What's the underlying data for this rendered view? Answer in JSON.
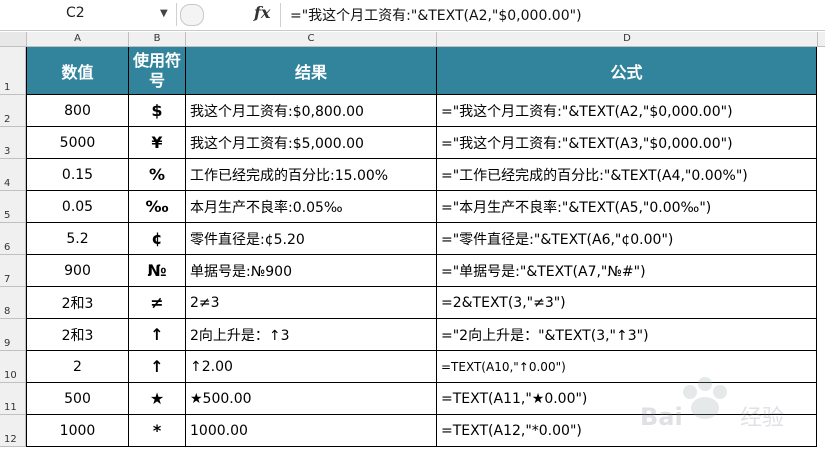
{
  "formula_bar": {
    "cell_ref": "C2",
    "fx_label": "fx",
    "formula": "=\"我这个月工资有:\"&TEXT(A2,\"$0,000.00\")"
  },
  "columns": [
    "A",
    "B",
    "C",
    "D"
  ],
  "rows": [
    "1",
    "2",
    "3",
    "4",
    "5",
    "6",
    "7",
    "8",
    "9",
    "10",
    "11",
    "12"
  ],
  "header": {
    "a": "数值",
    "b": "使用符号",
    "c": "结果",
    "d": "公式"
  },
  "data_rows": [
    {
      "a": "800",
      "b": "$",
      "c": "我这个月工资有:$0,800.00",
      "d": "=\"我这个月工资有:\"&TEXT(A2,\"$0,000.00\")"
    },
    {
      "a": "5000",
      "b": "¥",
      "c": "我这个月工资有:$5,000.00",
      "d": "=\"我这个月工资有:\"&TEXT(A3,\"$0,000.00\")"
    },
    {
      "a": "0.15",
      "b": "%",
      "c": "工作已经完成的百分比:15.00%",
      "d": "=\"工作已经完成的百分比:\"&TEXT(A4,\"0.00%\")"
    },
    {
      "a": "0.05",
      "b": "‰",
      "c": "本月生产不良率:0.05‰",
      "d": "=\"本月生产不良率:\"&TEXT(A5,\"0.00‰\")"
    },
    {
      "a": "5.2",
      "b": "¢",
      "c": "零件直径是:¢5.20",
      "d": "=\"零件直径是:\"&TEXT(A6,\"¢0.00\")"
    },
    {
      "a": "900",
      "b": "№",
      "c": "单据号是:№900",
      "d": "=\"单据号是:\"&TEXT(A7,\"№#\")"
    },
    {
      "a": "2和3",
      "b": "≠",
      "c": "2≠3",
      "d": "=2&TEXT(3,\"≠3\")"
    },
    {
      "a": "2和3",
      "b": "↑",
      "c": "2向上升是：↑3",
      "d": "=\"2向上升是：\"&TEXT(3,\"↑3\")"
    },
    {
      "a": "2",
      "b": "↑",
      "c": "↑2.00",
      "d": "=TEXT(A10,\"↑0.00\")"
    },
    {
      "a": "500",
      "b": "★",
      "c": "★500.00",
      "d": "=TEXT(A11,\"★0.00\")"
    },
    {
      "a": "1000",
      "b": "*",
      "c": "1000.00",
      "d": "=TEXT(A12,\"*0.00\")"
    }
  ],
  "colors": {
    "header_bg": "#31849b",
    "header_text": "#ffffff"
  }
}
